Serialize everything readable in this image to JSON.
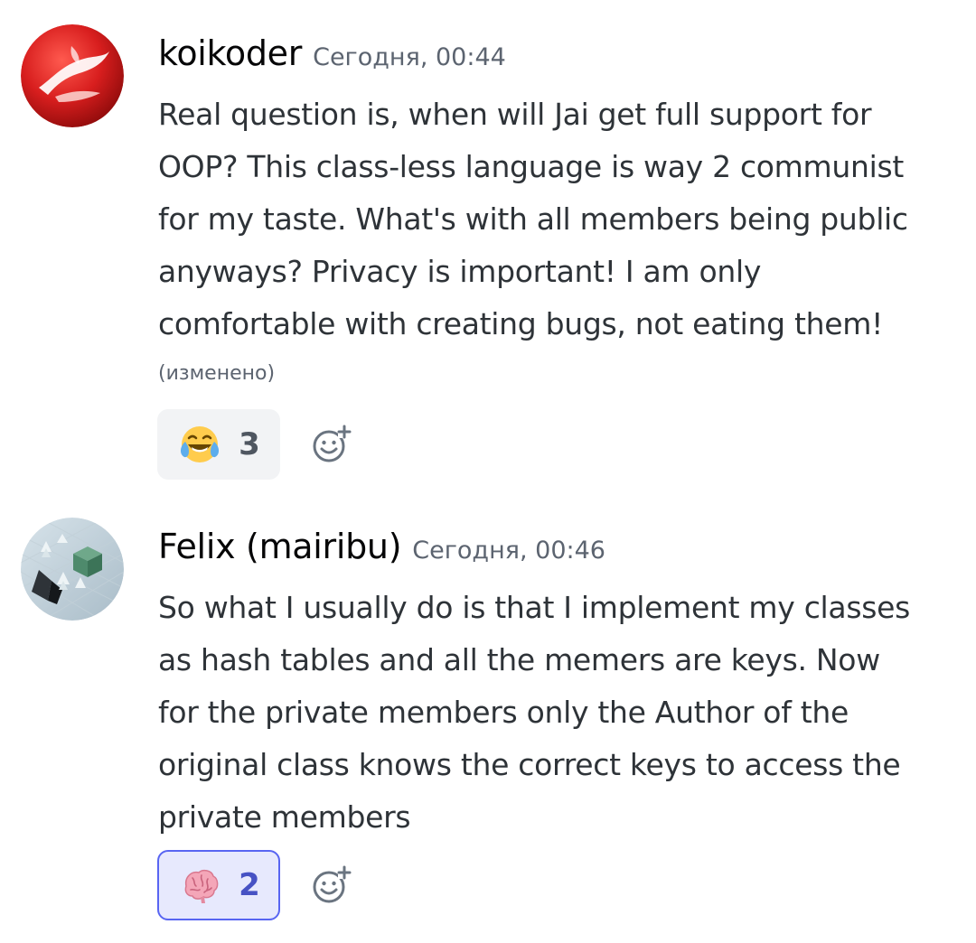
{
  "messages": [
    {
      "username": "koikoder",
      "timestamp": "Сегодня, 00:44",
      "avatar_icon": "red-swirl-avatar",
      "lines": [
        "Real question is, when will Jai get full support for",
        "OOP? This class-less language is way 2 communist",
        "for my taste. What's with all members being public",
        "anyways? Privacy is important! I am only",
        "comfortable with creating bugs, not eating them!"
      ],
      "edited": "(изменено)",
      "reaction": {
        "emoji": "face-with-tears-of-joy",
        "count": "3",
        "reacted": false
      }
    },
    {
      "username": "Felix (mairibu)",
      "timestamp": "Сегодня, 00:46",
      "avatar_icon": "isometric-scene-avatar",
      "lines": [
        "So what I usually do is that I implement my classes",
        "as hash tables and all the memers are keys. Now",
        "for the private members only the Author of the",
        "original class knows the correct keys to access the",
        "private members"
      ],
      "reaction": {
        "emoji": "brain",
        "count": "2",
        "reacted": true
      }
    }
  ],
  "colors": {
    "username": "#060607",
    "timestamp": "#5c6470",
    "text": "#2e3338",
    "reaction_bg": "#f2f3f5",
    "reacted_bg": "#e7e9fd",
    "reacted_border": "#5865f2",
    "avatar_red": "#d81e1e"
  }
}
